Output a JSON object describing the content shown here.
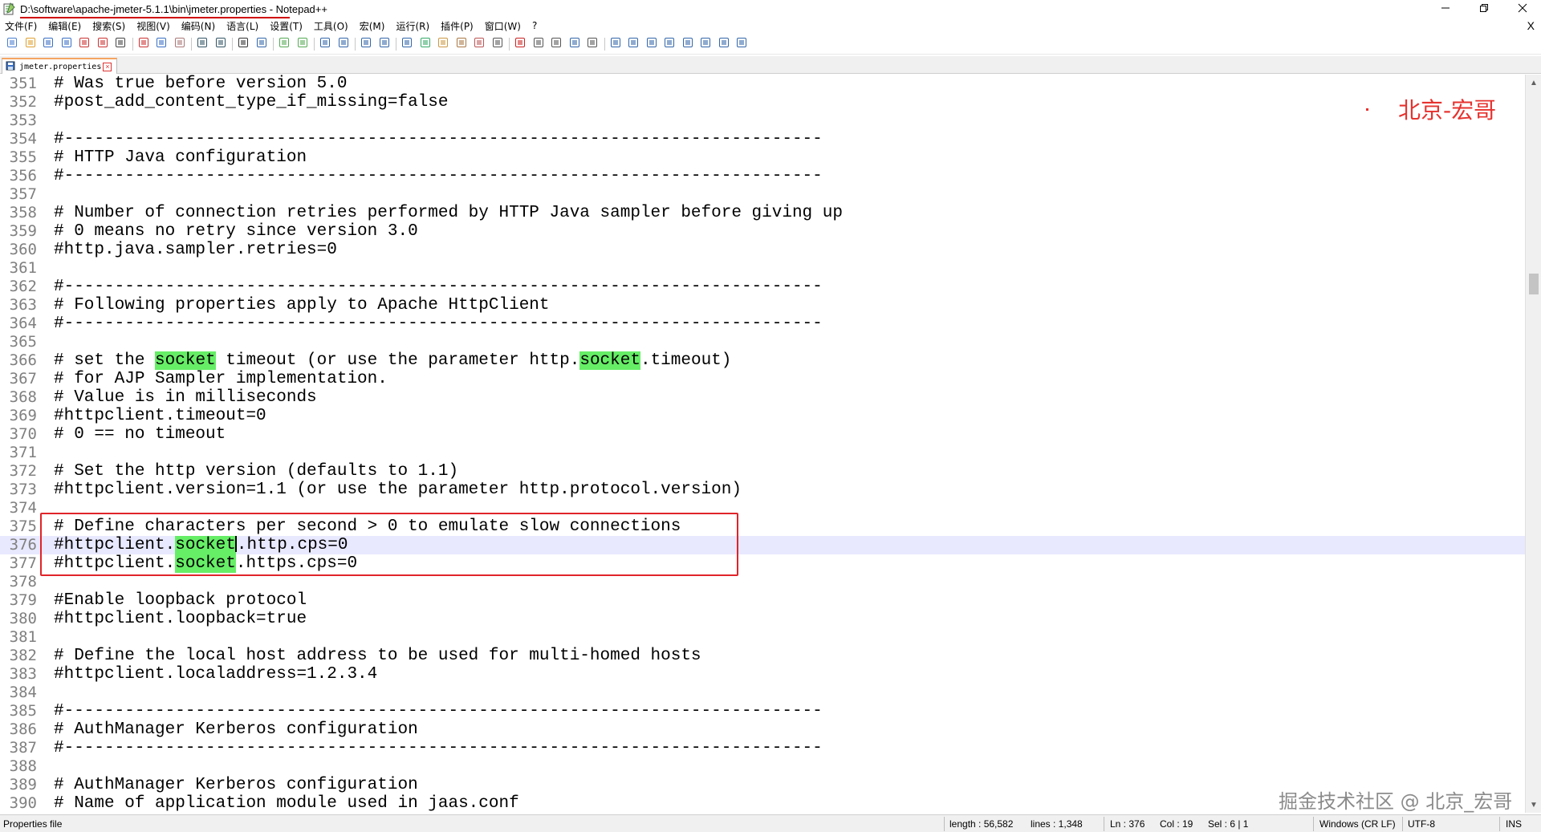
{
  "window": {
    "title": "D:\\software\\apache-jmeter-5.1.1\\bin\\jmeter.properties - Notepad++",
    "minimize_icon": "minimize-icon",
    "restore_icon": "restore-icon",
    "close_icon": "close-icon"
  },
  "menu": {
    "items": [
      "文件(F)",
      "编辑(E)",
      "搜索(S)",
      "视图(V)",
      "编码(N)",
      "语言(L)",
      "设置(T)",
      "工具(O)",
      "宏(M)",
      "运行(R)",
      "插件(P)",
      "窗口(W)",
      "?"
    ],
    "close_label": "X"
  },
  "toolbar": {
    "buttons": [
      "new-file-icon",
      "open-file-icon",
      "save-icon",
      "save-all-icon",
      "close-icon",
      "close-all-icon",
      "print-icon",
      "cut-icon",
      "copy-icon",
      "paste-icon",
      "undo-icon",
      "redo-icon",
      "find-icon",
      "replace-icon",
      "zoom-in-icon",
      "zoom-out-icon",
      "sync-vertical-icon",
      "sync-horizontal-icon",
      "word-wrap-icon",
      "show-all-chars-icon",
      "indent-guide-icon",
      "doc-map-icon",
      "function-list-icon",
      "folder-workspace-icon",
      "monitor-icon",
      "eye-icon",
      "record-macro-icon",
      "stop-record-icon",
      "play-macro-icon",
      "run-macro-multiple-icon",
      "save-macro-icon",
      "show-panel-icon",
      "table-icon",
      "grid-icon",
      "compare-icon",
      "arrow-up-icon",
      "arrow-down-icon",
      "list-icon",
      "window-icon"
    ]
  },
  "tab": {
    "label": "jmeter.properties",
    "close_symbol": "×"
  },
  "editor": {
    "lines": [
      {
        "num": "351",
        "text": "# Was true before version 5.0"
      },
      {
        "num": "352",
        "text": "#post_add_content_type_if_missing=false"
      },
      {
        "num": "353",
        "text": ""
      },
      {
        "num": "354",
        "text": "#---------------------------------------------------------------------------"
      },
      {
        "num": "355",
        "text": "# HTTP Java configuration"
      },
      {
        "num": "356",
        "text": "#---------------------------------------------------------------------------"
      },
      {
        "num": "357",
        "text": ""
      },
      {
        "num": "358",
        "text": "# Number of connection retries performed by HTTP Java sampler before giving up"
      },
      {
        "num": "359",
        "text": "# 0 means no retry since version 3.0"
      },
      {
        "num": "360",
        "text": "#http.java.sampler.retries=0"
      },
      {
        "num": "361",
        "text": ""
      },
      {
        "num": "362",
        "text": "#---------------------------------------------------------------------------"
      },
      {
        "num": "363",
        "text": "# Following properties apply to Apache HttpClient"
      },
      {
        "num": "364",
        "text": "#---------------------------------------------------------------------------"
      },
      {
        "num": "365",
        "text": ""
      },
      {
        "num": "366",
        "parts": [
          "# set the ",
          "socket",
          " timeout (or use the parameter http.",
          "socket",
          ".timeout)"
        ]
      },
      {
        "num": "367",
        "text": "# for AJP Sampler implementation."
      },
      {
        "num": "368",
        "text": "# Value is in milliseconds"
      },
      {
        "num": "369",
        "text": "#httpclient.timeout=0"
      },
      {
        "num": "370",
        "text": "# 0 == no timeout"
      },
      {
        "num": "371",
        "text": ""
      },
      {
        "num": "372",
        "text": "# Set the http version (defaults to 1.1)"
      },
      {
        "num": "373",
        "text": "#httpclient.version=1.1 (or use the parameter http.protocol.version)"
      },
      {
        "num": "374",
        "text": ""
      },
      {
        "num": "375",
        "text": "# Define characters per second > 0 to emulate slow connections"
      },
      {
        "num": "376",
        "parts": [
          "#httpclient.",
          "socket",
          ".http.cps=0"
        ],
        "current": true
      },
      {
        "num": "377",
        "parts": [
          "#httpclient.",
          "socket",
          ".https.cps=0"
        ]
      },
      {
        "num": "378",
        "text": ""
      },
      {
        "num": "379",
        "text": "#Enable loopback protocol"
      },
      {
        "num": "380",
        "text": "#httpclient.loopback=true"
      },
      {
        "num": "381",
        "text": ""
      },
      {
        "num": "382",
        "text": "# Define the local host address to be used for multi-homed hosts"
      },
      {
        "num": "383",
        "text": "#httpclient.localaddress=1.2.3.4"
      },
      {
        "num": "384",
        "text": ""
      },
      {
        "num": "385",
        "text": "#---------------------------------------------------------------------------"
      },
      {
        "num": "386",
        "text": "# AuthManager Kerberos configuration"
      },
      {
        "num": "387",
        "text": "#---------------------------------------------------------------------------"
      },
      {
        "num": "388",
        "text": ""
      },
      {
        "num": "389",
        "text": "# AuthManager Kerberos configuration"
      },
      {
        "num": "390",
        "text": "# Name of application module used in jaas.conf"
      }
    ]
  },
  "watermarks": {
    "top": "北京-宏哥",
    "bottom": "掘金技术社区 @ 北京_宏哥"
  },
  "statusbar": {
    "file_type": "Properties file",
    "length": "length : 56,582",
    "lines": "lines : 1,348",
    "ln": "Ln : 376",
    "col": "Col : 19",
    "sel": "Sel : 6 | 1",
    "eol": "Windows (CR LF)",
    "encoding": "UTF-8",
    "mode": "INS"
  },
  "colors": {
    "highlight": "#66ee66",
    "annotation": "#e0242a",
    "current_line": "#e8e8ff"
  }
}
